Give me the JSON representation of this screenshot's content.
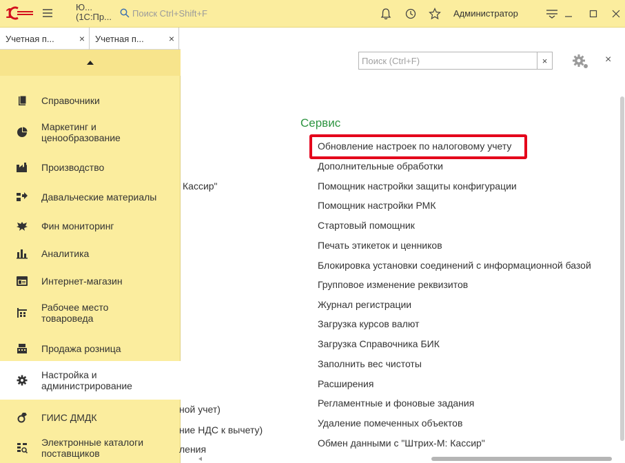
{
  "titlebar": {
    "app_title_line1": "Ю...",
    "app_title_line2": "(1С:Пр...",
    "search_placeholder": "Поиск Ctrl+Shift+F",
    "user": "Администратор",
    "accent": "#fbed9e"
  },
  "tabs": [
    {
      "label": "Учетная п...",
      "close": "×"
    },
    {
      "label": "Учетная п...",
      "close": "×"
    }
  ],
  "sidebar": {
    "items": [
      {
        "label": "Справочники",
        "icon": "folder-icon"
      },
      {
        "label": "Маркетинг и\nценообразование",
        "icon": "pie-chart-icon"
      },
      {
        "label": "Производство",
        "icon": "factory-icon"
      },
      {
        "label": "Давальческие материалы",
        "icon": "materials-icon"
      },
      {
        "label": "Фин мониторинг",
        "icon": "eagle-icon"
      },
      {
        "label": "Аналитика",
        "icon": "bar-chart-icon"
      },
      {
        "label": "Интернет-магазин",
        "icon": "shop-icon"
      },
      {
        "label": "Рабочее место\nтовароведа",
        "icon": "workplace-icon"
      },
      {
        "label": "Продажа розница",
        "icon": "register-icon"
      },
      {
        "label": "Настройка и\nадминистрирование",
        "icon": "gear-icon",
        "active": true
      },
      {
        "label": "ГИИС ДМДК",
        "icon": "ring-icon"
      },
      {
        "label": "Электронные каталоги\nпоставщиков",
        "icon": "catalog-icon"
      }
    ]
  },
  "main": {
    "search_placeholder": "Поиск (Ctrl+F)",
    "clear": "×",
    "close": "×",
    "section_title": "Сервис",
    "section_color": "#2c9440",
    "items": [
      "Обновление настроек по налоговому учету",
      "Дополнительные обработки",
      "Помощник настройки защиты конфигурации",
      "Помощник настройки РМК",
      "Стартовый помощник",
      "Печать этикеток и ценников",
      "Блокировка установки соединений с информационной базой",
      "Групповое изменение реквизитов",
      "Журнал регистрации",
      "Загрузка курсов валют",
      "Загрузка Справочника БИК",
      "Заполнить вес чистоты",
      "Расширения",
      "Регламентные и фоновые задания",
      "Удаление помеченных объектов",
      "Обмен данными с \"Штрих-М: Кассир\""
    ],
    "left_fragments": [
      "Кассир\"",
      "ной учет)",
      "ние НДС к вычету)",
      "ления"
    ],
    "highlight_color": "#e4001b"
  }
}
